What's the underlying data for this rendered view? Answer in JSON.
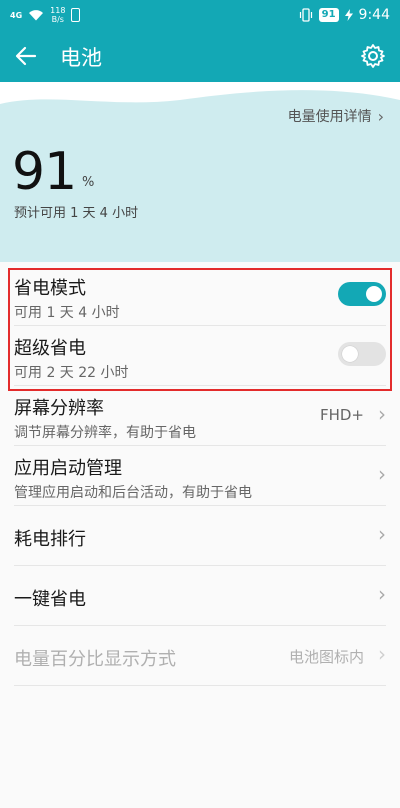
{
  "status_bar": {
    "signal": "4G",
    "speed_value": "118",
    "speed_unit": "B/s",
    "battery_level": "91",
    "time": "9:44"
  },
  "app_bar": {
    "title": "电池",
    "back_icon": "back-arrow-icon",
    "settings_icon": "gear-icon"
  },
  "battery": {
    "details_link": "电量使用详情",
    "percent": "91",
    "unit": "%",
    "estimate": "预计可用 1 天 4 小时"
  },
  "settings": [
    {
      "label": "省电模式",
      "sub": "可用 1 天 4 小时",
      "toggle": true
    },
    {
      "label": "超级省电",
      "sub": "可用 2 天 22 小时",
      "toggle": false
    },
    {
      "label": "屏幕分辨率",
      "sub": "调节屏幕分辨率，有助于省电",
      "value": "FHD+"
    },
    {
      "label": "应用启动管理",
      "sub": "管理应用启动和后台活动，有助于省电"
    },
    {
      "label": "耗电排行"
    },
    {
      "label": "一键省电"
    },
    {
      "label": "电量百分比显示方式",
      "value": "电池图标内",
      "disabled": true
    }
  ],
  "colors": {
    "accent": "#13a8b5",
    "hero_bg": "#cfecef",
    "highlight": "#e32b2b"
  }
}
